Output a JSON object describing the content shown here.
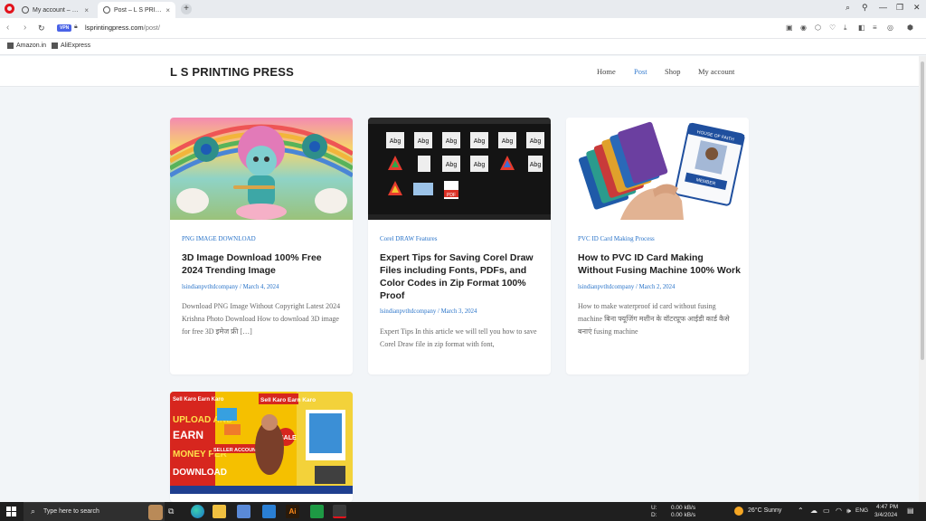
{
  "browser": {
    "tabs": [
      {
        "label": "My account – L S PRINTIN"
      },
      {
        "label": "Post – L S PRINTING PRES"
      }
    ],
    "new_tab": "+",
    "url_domain": "lsprintingpress.com",
    "url_path": "/post/",
    "vpn_label": "VPN",
    "bookmarks": [
      {
        "label": "Amazon.in"
      },
      {
        "label": "AliExpress"
      }
    ]
  },
  "site": {
    "title": "L S PRINTING PRESS",
    "nav": [
      {
        "label": "Home"
      },
      {
        "label": "Post"
      },
      {
        "label": "Shop"
      },
      {
        "label": "My account"
      }
    ]
  },
  "posts": [
    {
      "category": "PNG IMAGE DOWNLOAD",
      "title": "3D Image Download 100% Free 2024 Trending Image",
      "author": "lsindianpvtltdcompany",
      "date": "March 4, 2024",
      "excerpt": "Download PNG Image Without Copyright Latest 2024 Krishna Photo Download How to download 3D image for free 3D इमेज फ्री […]"
    },
    {
      "category": "Corel DRAW Features",
      "title": "Expert Tips for Saving Corel Draw Files including Fonts, PDFs, and Color Codes in Zip Format 100% Proof",
      "author": "lsindianpvtltdcompany",
      "date": "March 3, 2024",
      "excerpt": "Expert Tips In this article we will tell you how to save Corel Draw file in zip format with font,"
    },
    {
      "category": "PVC ID Card Making Process",
      "title": "How to PVC ID Card Making Without Fusing Machine 100% Work",
      "author": "lsindianpvtltdcompany",
      "date": "March 2, 2024",
      "excerpt": "How to make waterproof id card without fusing machine बिना फ्यूजिंग मशीन के वॉटरप्रूफ आईडी कार्ड कैसे बनाएं fusing machine"
    },
    {
      "category": "",
      "title": "",
      "author": "",
      "date": "",
      "excerpt": "",
      "thumb_texts": [
        "Sell Karo Earn Karo",
        "UPLOAD AND",
        "EARN",
        "MONEY PER",
        "DOWNLOAD",
        "SELLER ACCOUNT",
        "SALE"
      ]
    }
  ],
  "thumb_labels": {
    "corel_tiles": [
      "Abg",
      "Abg",
      "Abg",
      "Abg",
      "Abg",
      "Abg",
      "Abg",
      "Abg",
      "Abg",
      "PDF"
    ],
    "id_card_header": "HOUSE OF FAITH",
    "id_card_badge": "MEMBER"
  },
  "taskbar": {
    "search_placeholder": "Type here to search",
    "net_up": "0.00 kB/s",
    "net_down": "0.00 kB/s",
    "net_up_label": "U:",
    "net_down_label": "D:",
    "weather": "26°C  Sunny",
    "lang": "ENG",
    "time": "4:47 PM",
    "date": "3/4/2024"
  },
  "colors": {
    "accent": "#2a74c9",
    "nav_current": "#3a7fd0",
    "opera_red": "#e2131c",
    "page_bg": "#f2f5f8"
  }
}
